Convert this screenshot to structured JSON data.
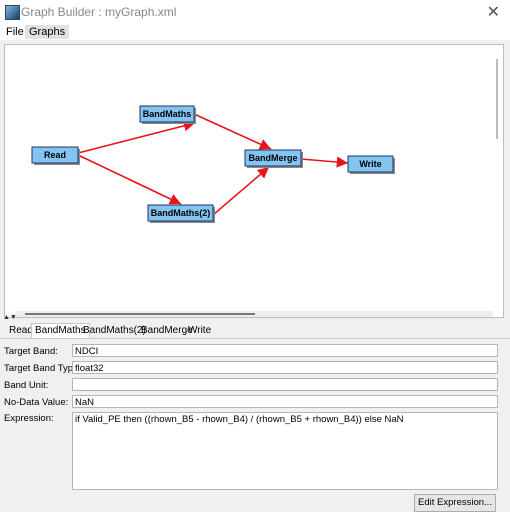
{
  "window": {
    "title": "Graph Builder : myGraph.xml",
    "close_symbol": "✕"
  },
  "menu": {
    "items": [
      "File",
      "Graphs"
    ]
  },
  "graph": {
    "nodes": [
      {
        "id": "read",
        "label": "Read"
      },
      {
        "id": "bandmaths",
        "label": "BandMaths"
      },
      {
        "id": "bandmaths2",
        "label": "BandMaths(2)"
      },
      {
        "id": "bandmerge",
        "label": "BandMerge"
      },
      {
        "id": "write",
        "label": "Write"
      }
    ],
    "edges": [
      [
        "read",
        "bandmaths"
      ],
      [
        "read",
        "bandmaths2"
      ],
      [
        "bandmaths",
        "bandmerge"
      ],
      [
        "bandmaths2",
        "bandmerge"
      ],
      [
        "bandmerge",
        "write"
      ]
    ],
    "edge_color": "#e8141b",
    "node_color": "#83c4f2"
  },
  "tabs": {
    "items": [
      "Read",
      "BandMaths",
      "BandMaths(2)",
      "BandMerge",
      "Write"
    ],
    "active": "BandMaths"
  },
  "form": {
    "target_band_label": "Target Band:",
    "target_band_value": "NDCI",
    "target_band_type_label": "Target Band Type:",
    "target_band_type_value": "float32",
    "band_unit_label": "Band Unit:",
    "band_unit_value": "",
    "no_data_label": "No-Data Value:",
    "no_data_value": "NaN",
    "expression_label": "Expression:",
    "expression_value": "if Valid_PE then ((rhown_B5 - rhown_B4) / (rhown_B5 + rhown_B4)) else NaN",
    "edit_expression_button": "Edit Expression..."
  }
}
